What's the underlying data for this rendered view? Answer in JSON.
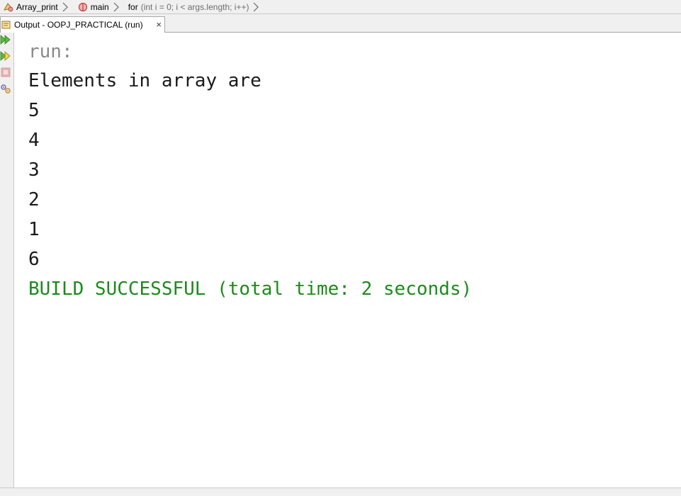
{
  "breadcrumb": {
    "items": [
      {
        "label": "Array_print",
        "icon": "class-icon"
      },
      {
        "label": "main",
        "icon": "method-icon"
      },
      {
        "label": "for",
        "detail": "(int i = 0; i < args.length; i++)"
      }
    ]
  },
  "tab": {
    "label": "Output - OOPJ_PRACTICAL (run)",
    "close": "×"
  },
  "toolbar": {
    "buttons": [
      "rerun-icon",
      "rerun-with-options-icon",
      "stop-icon",
      "settings-icon"
    ]
  },
  "output": {
    "lines": [
      {
        "text": "run:",
        "kind": "run"
      },
      {
        "text": "Elements in array are",
        "kind": "normal"
      },
      {
        "text": "5",
        "kind": "normal"
      },
      {
        "text": "4",
        "kind": "normal"
      },
      {
        "text": "3",
        "kind": "normal"
      },
      {
        "text": "2",
        "kind": "normal"
      },
      {
        "text": "1",
        "kind": "normal"
      },
      {
        "text": "6",
        "kind": "normal"
      },
      {
        "text": "BUILD SUCCESSFUL (total time: 2 seconds)",
        "kind": "ok"
      }
    ]
  },
  "colors": {
    "success": "#1d8a1d",
    "run": "#8a8a8a",
    "chrome": "#f0f0f0"
  }
}
